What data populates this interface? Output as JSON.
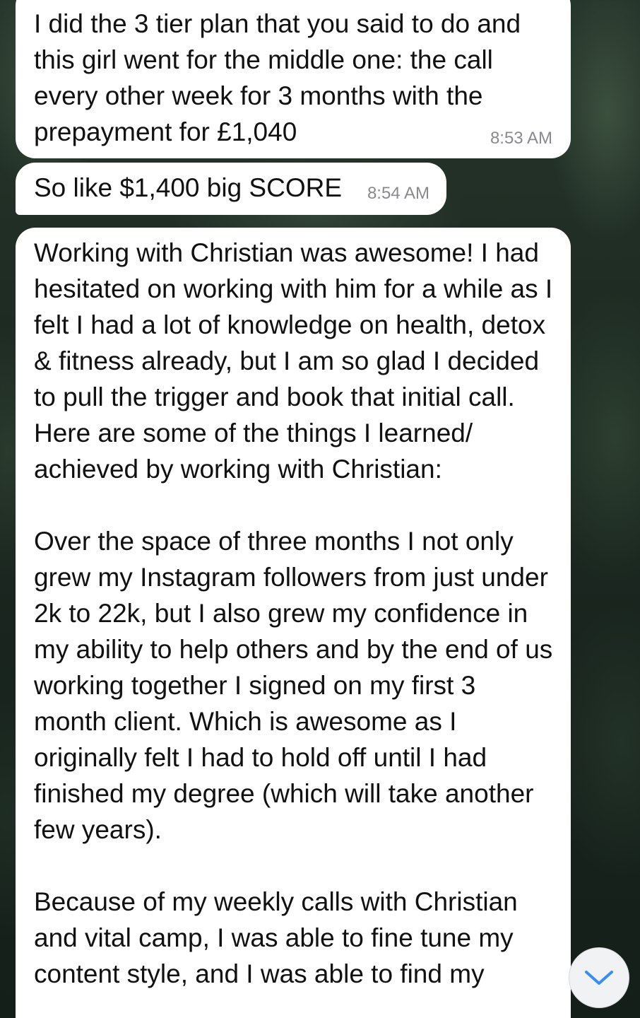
{
  "messages": [
    {
      "text": "I did the 3 tier plan that you said to do and this girl went for the middle one: the call every other week for 3 months with the prepayment for £1,040",
      "time": "8:53 AM"
    },
    {
      "text": "So like $1,400 big SCORE",
      "time": "8:54 AM"
    },
    {
      "text": "Working with Christian was awesome! I had hesitated on working with him for a while as I felt I had a lot of knowledge on health, detox & fitness already, but I am so glad I decided to pull the trigger and book that initial call. Here are some of the things I learned/ achieved by working with Christian:\n\nOver the space of three months I not only grew my Instagram followers from just under 2k to 22k, but I also grew my confidence in my ability to help others and by the end of us working together I signed on my first 3 month client. Which is awesome as I originally felt I had to hold off until I had finished my degree (which will take another few years).\n\nBecause of my weekly calls with Christian and vital camp, I was able to fine tune my content style, and I was able to find my"
    }
  ],
  "scroll_button": {
    "icon": "chevron-down-icon",
    "color": "#3a8ef0"
  },
  "colors": {
    "bubble": "#ffffff",
    "timestamp": "#8a8a8e",
    "background": "#1d2a22"
  }
}
